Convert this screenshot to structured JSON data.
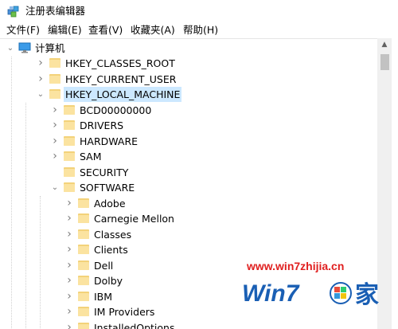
{
  "window": {
    "title": "注册表编辑器"
  },
  "menu": {
    "items": [
      "文件(F)",
      "编辑(E)",
      "查看(V)",
      "收藏夹(A)",
      "帮助(H)"
    ]
  },
  "tree": {
    "root_label": "计算机",
    "selected": "HKEY_LOCAL_MACHINE",
    "rows": [
      {
        "label": "HKEY_CLASSES_ROOT",
        "level": 1,
        "expander": "collapsed"
      },
      {
        "label": "HKEY_CURRENT_USER",
        "level": 1,
        "expander": "collapsed"
      },
      {
        "label": "HKEY_LOCAL_MACHINE",
        "level": 1,
        "expander": "expanded"
      },
      {
        "label": "BCD00000000",
        "level": 2,
        "expander": "collapsed"
      },
      {
        "label": "DRIVERS",
        "level": 2,
        "expander": "collapsed"
      },
      {
        "label": "HARDWARE",
        "level": 2,
        "expander": "collapsed"
      },
      {
        "label": "SAM",
        "level": 2,
        "expander": "collapsed"
      },
      {
        "label": "SECURITY",
        "level": 2,
        "expander": "none"
      },
      {
        "label": "SOFTWARE",
        "level": 2,
        "expander": "expanded"
      },
      {
        "label": "Adobe",
        "level": 3,
        "expander": "collapsed"
      },
      {
        "label": "Carnegie Mellon",
        "level": 3,
        "expander": "collapsed"
      },
      {
        "label": "Classes",
        "level": 3,
        "expander": "collapsed"
      },
      {
        "label": "Clients",
        "level": 3,
        "expander": "collapsed"
      },
      {
        "label": "Dell",
        "level": 3,
        "expander": "collapsed"
      },
      {
        "label": "Dolby",
        "level": 3,
        "expander": "collapsed"
      },
      {
        "label": "IBM",
        "level": 3,
        "expander": "collapsed"
      },
      {
        "label": "IM Providers",
        "level": 3,
        "expander": "collapsed"
      },
      {
        "label": "InstalledOptions",
        "level": 3,
        "expander": "collapsed"
      }
    ]
  },
  "watermark": {
    "url": "www.win7zhijia.cn",
    "logo_text": "Win7",
    "logo_char": "家"
  },
  "colors": {
    "selection": "#cce8ff",
    "folder": "#f3d27a",
    "watermark_red": "#e02020",
    "watermark_blue": "#1a5fb4"
  }
}
